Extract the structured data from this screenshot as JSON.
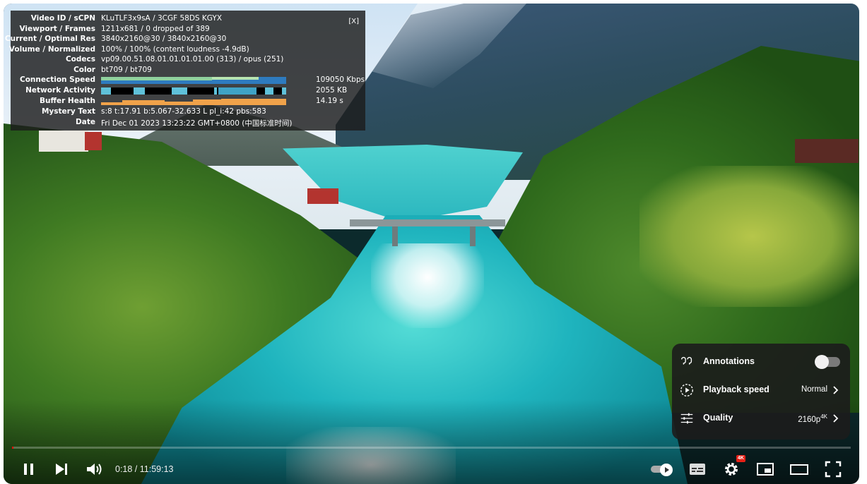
{
  "stats": {
    "close_label": "[X]",
    "rows": [
      {
        "key": "Video ID / sCPN",
        "value": "KLuTLF3x9sA  /  3CGF  58DS  KGYX"
      },
      {
        "key": "Viewport / Frames",
        "value": "1211x681 / 0 dropped of 389"
      },
      {
        "key": "Current / Optimal Res",
        "value": "3840x2160@30 / 3840x2160@30"
      },
      {
        "key": "Volume / Normalized",
        "value": "100% / 100% (content loudness -4.9dB)"
      },
      {
        "key": "Codecs",
        "value": "vp09.00.51.08.01.01.01.01.00 (313) / opus (251)"
      },
      {
        "key": "Color",
        "value": "bt709 / bt709"
      }
    ],
    "connection_speed": {
      "key": "Connection Speed",
      "value": "109050 Kbps"
    },
    "network_activity": {
      "key": "Network Activity",
      "value": "2055 KB"
    },
    "buffer_health": {
      "key": "Buffer Health",
      "value": "14.19 s"
    },
    "mystery_text": {
      "key": "Mystery Text",
      "value": "s:8 t:17.91 b:5.067-32.633 L pl_i:42 pbs:583"
    },
    "date": {
      "key": "Date",
      "value": "Fri Dec 01 2023 13:23:22 GMT+0800 (中国标准时间)"
    }
  },
  "settings_menu": {
    "annotations": {
      "label": "Annotations",
      "icon": "annotations-icon",
      "enabled": false
    },
    "playback_speed": {
      "label": "Playback speed",
      "value": "Normal",
      "icon": "playback-speed-icon"
    },
    "quality": {
      "label": "Quality",
      "value": "2160p",
      "badge": "4K",
      "icon": "quality-sliders-icon"
    }
  },
  "controls": {
    "current_time": "0:18",
    "duration": "11:59:13",
    "time_display": "0:18 / 11:59:13",
    "settings_badge": "4K",
    "progress_fraction": 0.0004,
    "autoplay": true
  },
  "colors": {
    "panel_bg": "#1c1c1c",
    "progress": "#ff0000",
    "connection_graph": "#2e7bbf",
    "network_graph": "#3fa3c6",
    "buffer_graph": "#f0a24a"
  }
}
